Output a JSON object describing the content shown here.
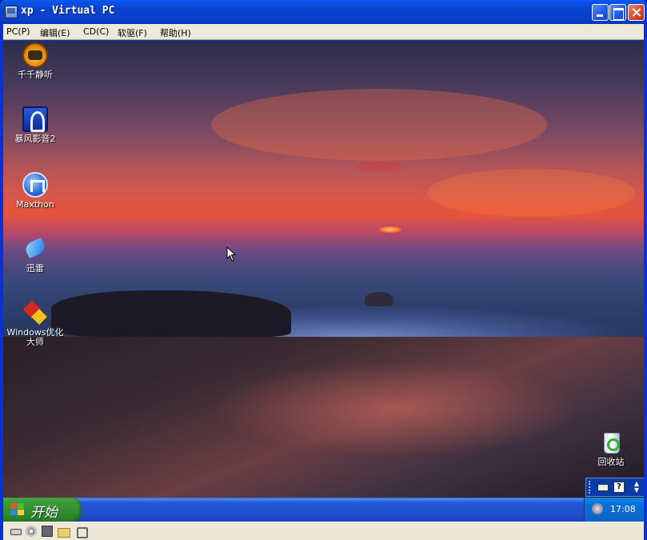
{
  "window": {
    "title": "xp - Virtual PC",
    "icon": "virtual-pc-icon"
  },
  "menu": [
    {
      "label": "PC(P)"
    },
    {
      "label": "编辑(E)"
    },
    {
      "label": "CD(C)"
    },
    {
      "label": "软驱(F)"
    },
    {
      "label": "帮助(H)"
    }
  ],
  "desktop": {
    "icons": [
      {
        "label": "千千静听",
        "icon": "ttplayer-icon"
      },
      {
        "label": "暴风影音2",
        "icon": "storm-player-icon"
      },
      {
        "label": "Maxthon",
        "icon": "maxthon-browser-icon"
      },
      {
        "label": "迅雷",
        "icon": "thunder-icon"
      },
      {
        "label": "Windows优化\n大师",
        "icon": "windows-optimizer-icon"
      },
      {
        "label": "回收站",
        "icon": "recycle-bin-icon"
      }
    ]
  },
  "taskbar": {
    "start_label": "开始",
    "clock": "17:08"
  },
  "vpc_tray": {
    "help_label": "?",
    "scroll_up": "▲",
    "scroll_down": "▼"
  },
  "statusbar": {
    "icons": [
      "hard-disk-icon",
      "cd-drive-icon",
      "floppy-icon",
      "shared-folder-icon",
      "network-icon"
    ]
  }
}
